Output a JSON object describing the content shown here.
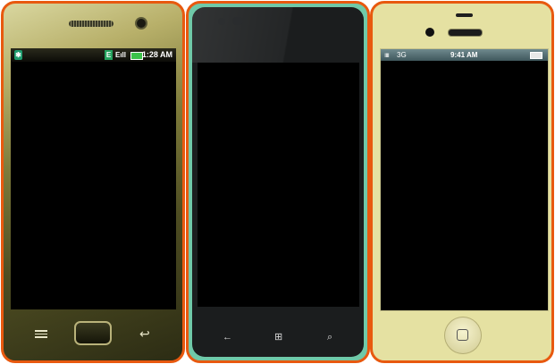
{
  "devices": [
    {
      "kind": "android",
      "statusbar": {
        "time": "1:28 AM",
        "bluetooth_icon": "bluetooth-icon",
        "e_label": "E",
        "signal_label": "Eıll"
      },
      "nav": {
        "menu_icon": "menu-icon",
        "home_icon": "home-button",
        "back_icon": "back-arrow-icon"
      },
      "frame_color": "#e8590f"
    },
    {
      "kind": "windows",
      "nav": {
        "back_glyph": "←",
        "windows_glyph": "⊞",
        "search_glyph": "⌕"
      },
      "frame_color": "#e8590f",
      "accent_color": "#6fc9a8"
    },
    {
      "kind": "iphone",
      "statusbar": {
        "signal_bars": "ıııı",
        "carrier": "3G",
        "time": "9:41 AM"
      },
      "frame_color": "#e8590f",
      "body_color": "#e5e1a2"
    }
  ]
}
